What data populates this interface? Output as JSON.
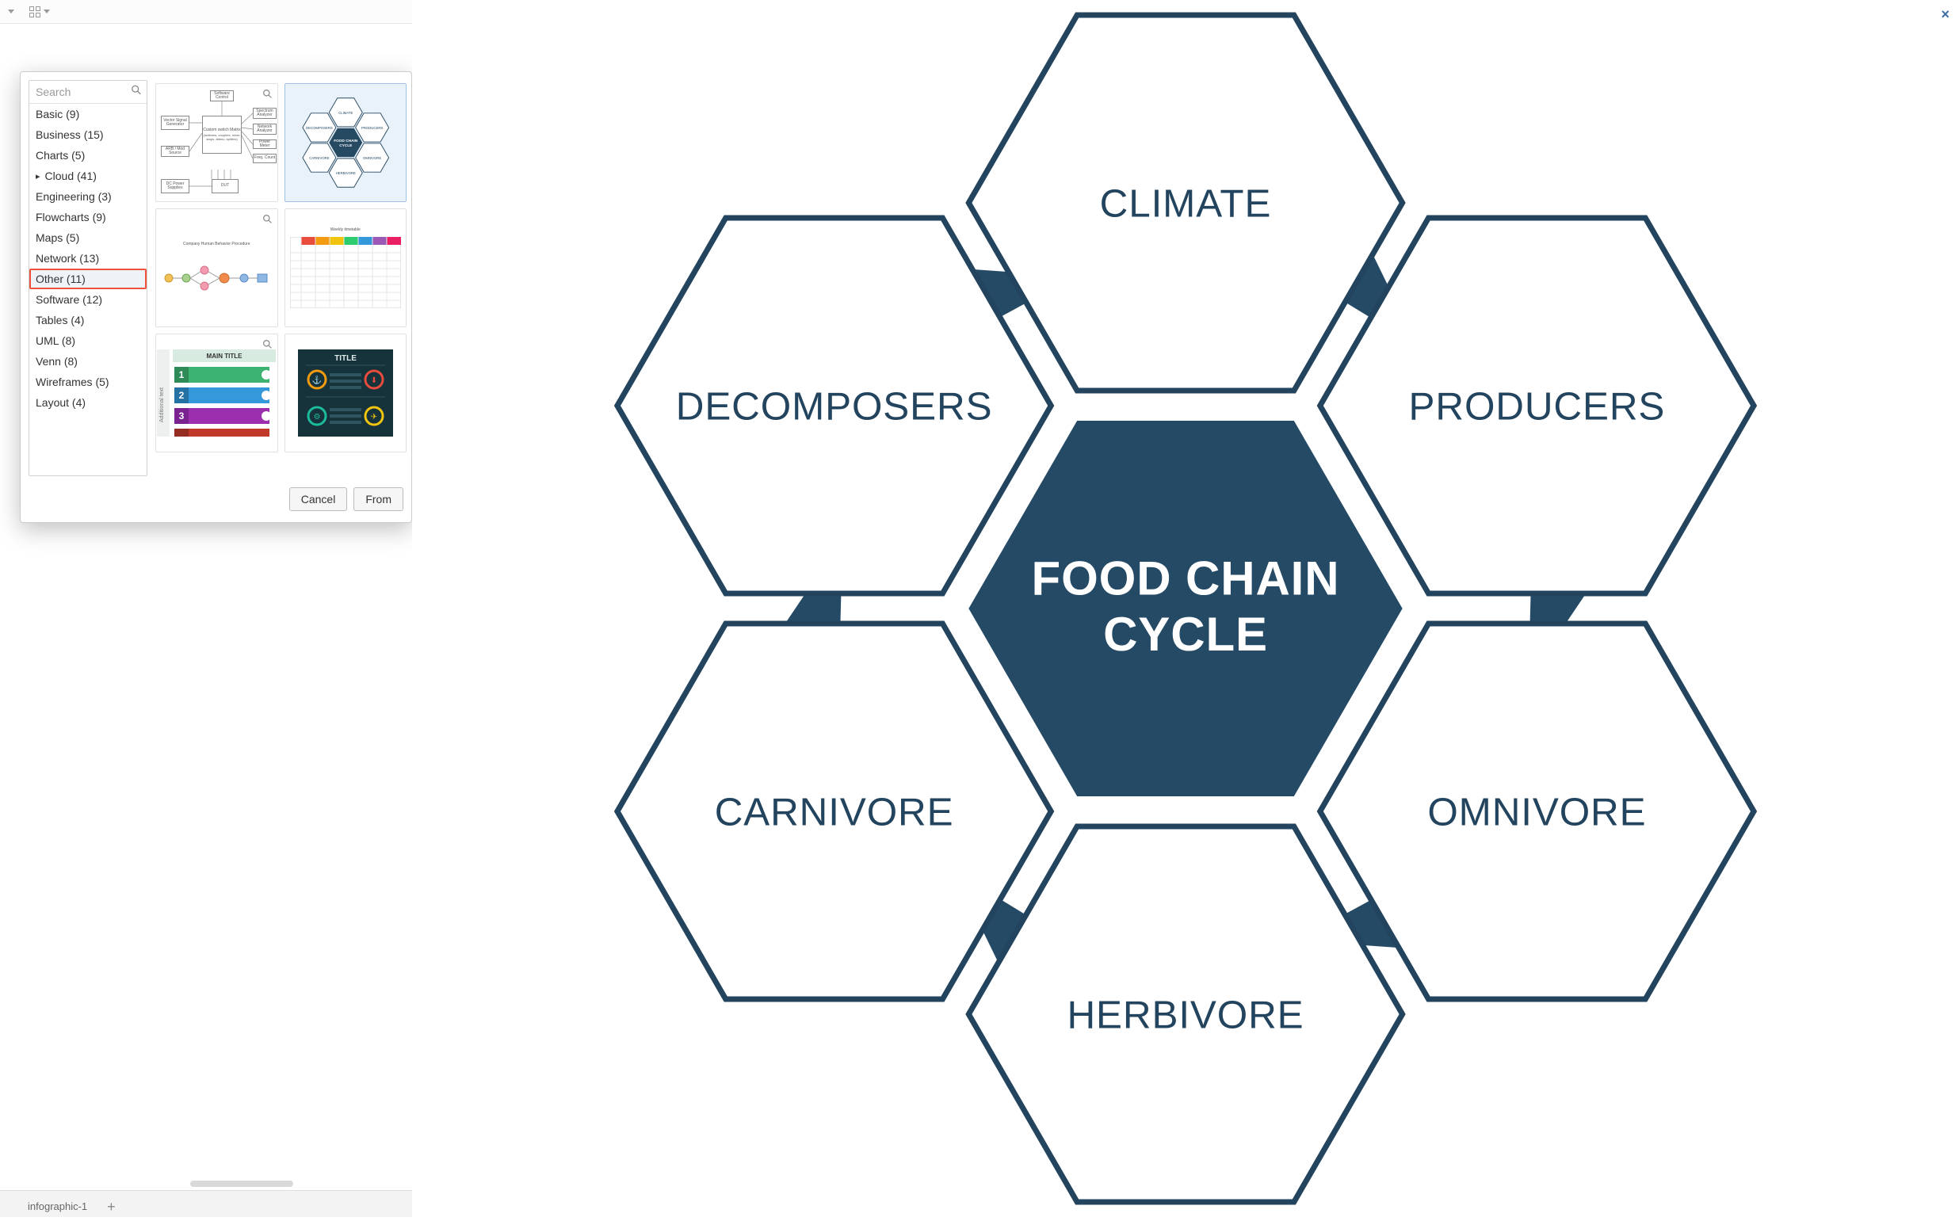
{
  "toolbar": {
    "view_button": "view",
    "grid_button": "grid"
  },
  "dialog": {
    "search_placeholder": "Search",
    "categories": [
      {
        "label": "Basic (9)"
      },
      {
        "label": "Business (15)"
      },
      {
        "label": "Charts (5)"
      },
      {
        "label": "Cloud (41)",
        "expandable": true
      },
      {
        "label": "Engineering (3)"
      },
      {
        "label": "Flowcharts (9)"
      },
      {
        "label": "Maps (5)"
      },
      {
        "label": "Network (13)"
      },
      {
        "label": "Other (11)",
        "selected": true
      },
      {
        "label": "Software (12)"
      },
      {
        "label": "Tables (4)"
      },
      {
        "label": "UML (8)"
      },
      {
        "label": "Venn (8)"
      },
      {
        "label": "Wireframes (5)"
      },
      {
        "label": "Layout (4)"
      }
    ],
    "cancel_label": "Cancel",
    "from_label": "From",
    "thumb1": {
      "vsg": "Vector Signal\nGenerator",
      "arb": "ARB / Mod\nSource",
      "dcp": "DC Power\nSupplies",
      "csm": "Custom switch\nMatrix",
      "sub": "(switches, couplers,\nmixer, amps, attenu,\nspliters)",
      "dut": "DUT",
      "sw": "Software\nControl",
      "sa": "Spectrum\nAnalyzer",
      "na": "Network\nAnalyzer",
      "pm": "Power Meter",
      "fc": "Freq. Count"
    },
    "thumb2": {
      "center": "FOOD CHAIN\nCYCLE",
      "top": "CLIMATE",
      "tl": "DECOMPOSERS",
      "tr": "PRODUCERS",
      "bl": "CARNIVORE",
      "br": "OMNIVORE",
      "bot": "HERBIVORE"
    },
    "thumb3": {
      "caption": "Company Human Behavior Procedure"
    },
    "thumb4": {
      "caption": "Weekly timetable"
    },
    "thumb5": {
      "main": "MAIN TITLE",
      "side": "Additional text"
    },
    "thumb6": {
      "title": "TITLE"
    }
  },
  "tabs": {
    "active_tab": "infographic-1"
  },
  "preview": {
    "close": "×",
    "center_line1": "FOOD CHAIN",
    "center_line2": "CYCLE",
    "nodes": {
      "top": "CLIMATE",
      "tr": "PRODUCERS",
      "br": "OMNIVORE",
      "bot": "HERBIVORE",
      "bl": "CARNIVORE",
      "tl": "DECOMPOSERS"
    },
    "color_dark": "#254a66",
    "color_stroke": "#23445e"
  }
}
